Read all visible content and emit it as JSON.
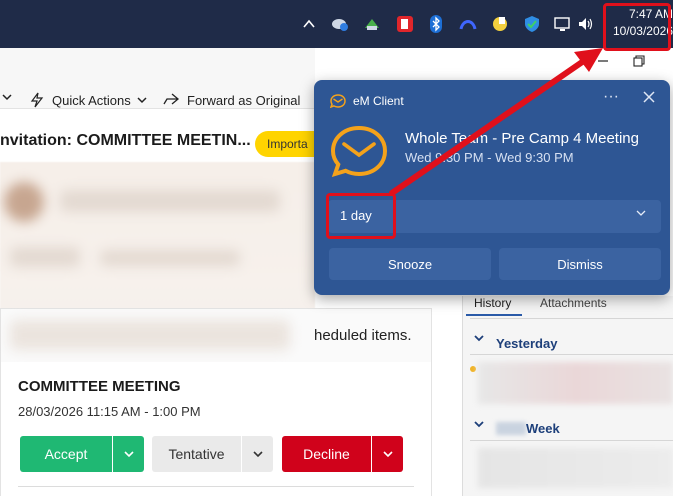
{
  "taskbar": {
    "time": "7:47 AM",
    "date": "10/03/2026",
    "icons": [
      "chevron-up-icon",
      "cloud-sync-icon",
      "network-app-icon",
      "red-app-icon",
      "bluetooth-icon",
      "app-icon",
      "pinwheel-icon",
      "shield-icon",
      "monitor-icon",
      "speaker-icon"
    ]
  },
  "toolbar": {
    "quick_actions": "Quick Actions",
    "forward": "Forward as Original"
  },
  "email": {
    "subject": "nvitation: COMMITTEE MEETIN...",
    "badge": "Importa",
    "schedule_text": "heduled items."
  },
  "meeting": {
    "title": "COMMITTEE MEETING",
    "time": "28/03/2026 11:15 AM - 1:00 PM",
    "accept": "Accept",
    "tentative": "Tentative",
    "decline": "Decline"
  },
  "right_panel": {
    "tab_history": "History",
    "tab_attachments": "Attachments",
    "section_yesterday": "Yesterday",
    "section_week": "Week"
  },
  "notification": {
    "app_name": "eM Client",
    "heading": "Whole Team - Pre Camp 4 Meeting",
    "time_range": "Wed 9:30 PM - Wed 9:30 PM",
    "snooze_value": "1 day",
    "snooze_button": "Snooze",
    "dismiss_button": "Dismiss"
  },
  "colors": {
    "taskbar": "#1f2b48",
    "notification_bg": "#2e5694",
    "accept": "#1fb873",
    "decline": "#d0021b",
    "annotation_red": "#e0101b",
    "badge_yellow": "#ffd400"
  }
}
